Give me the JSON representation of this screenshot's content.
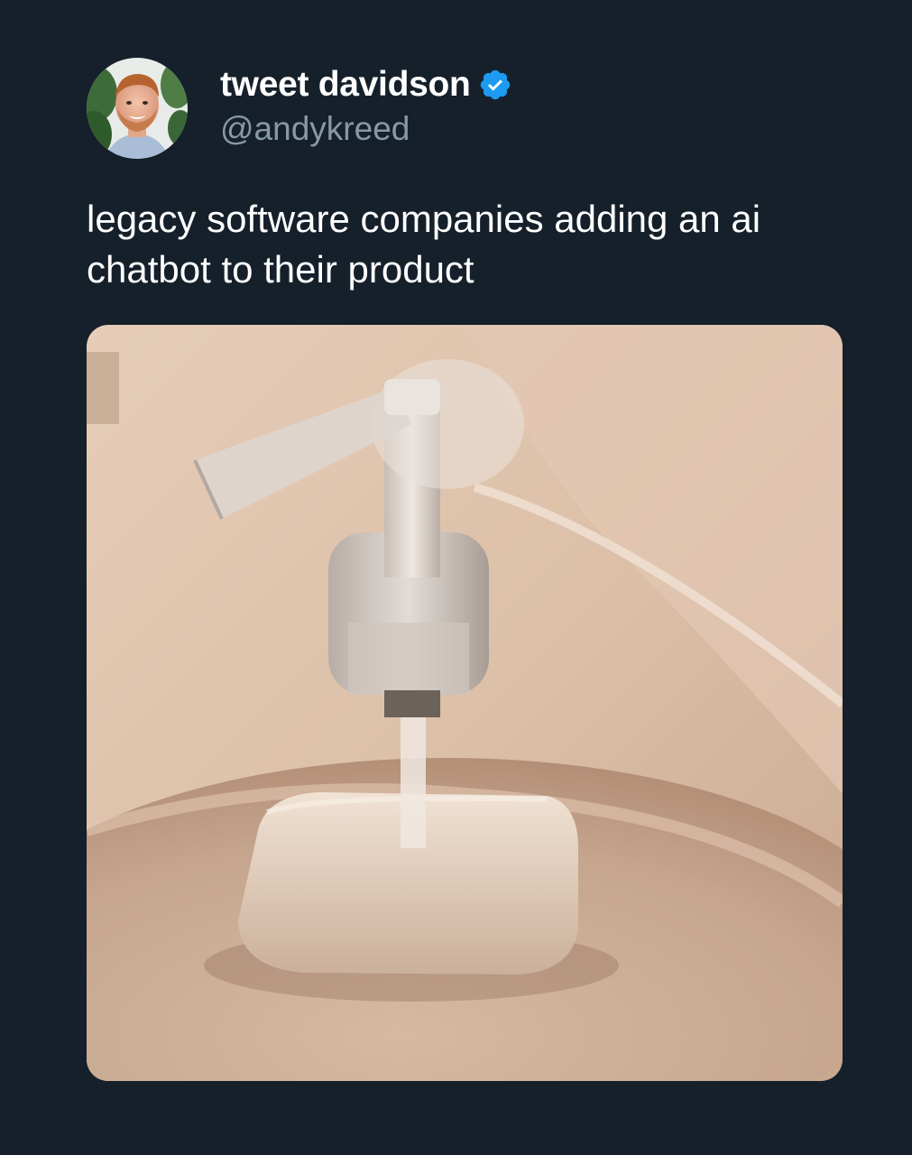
{
  "tweet": {
    "display_name": "tweet davidson",
    "handle": "@andykreed",
    "text": "legacy software companies adding an ai chatbot to their product",
    "verified": true
  },
  "icons": {
    "verified": "verified-badge-icon"
  },
  "colors": {
    "background": "#15202b",
    "name": "#ffffff",
    "handle": "#8899a6",
    "verified": "#1d9bf0"
  }
}
